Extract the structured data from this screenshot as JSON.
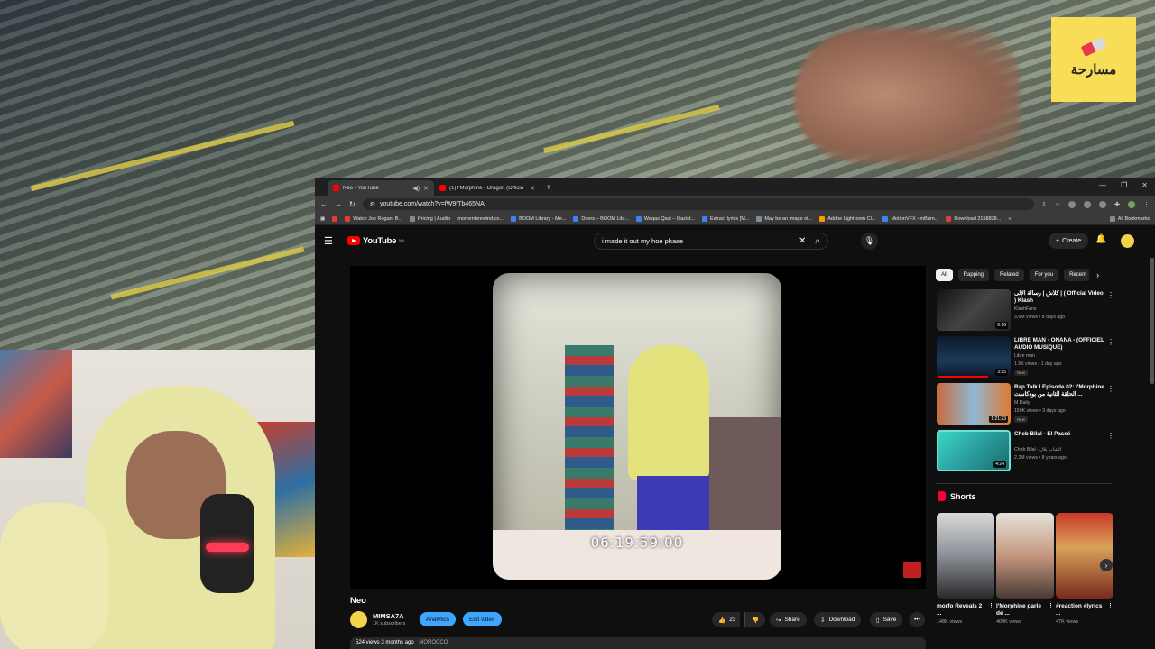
{
  "overlay": {
    "logo_text": "مسارحة"
  },
  "browser": {
    "tabs": [
      {
        "label": "Neo - YouTube",
        "active": true
      },
      {
        "label": "(1) l'Morphine - Dragon (Officia",
        "active": false
      }
    ],
    "url": "youtube.com/watch?v=fW9fTb465NA",
    "bookmarks": [
      "Watch Joe Rogan: B...",
      "Pricing | Audiio",
      "momentsrewind.co...",
      "BOOM Library - Me...",
      "Doors – BOOM Libr...",
      "Waqas Qazi – Qazist...",
      "Extract lyrics [M...",
      "May be an image of...",
      "Adobe Lightroom Cl...",
      "MotionVFX - mBurn...",
      "Download 2158838..."
    ],
    "all_bookmarks": "All Bookmarks"
  },
  "youtube": {
    "logo": "YouTube",
    "region": "MA",
    "search_query": "i made it out my hoe phase",
    "create_label": "Create",
    "video": {
      "timecode": "06:19:59:00",
      "title": "Neo",
      "channel": "MIMSA7A",
      "subscribers": "1K subscribers",
      "analytics_label": "Analytics",
      "edit_label": "Edit video",
      "likes": "23",
      "share_label": "Share",
      "download_label": "Download",
      "save_label": "Save",
      "views": "524 views",
      "age": "3 months ago",
      "location": "MOROCCO"
    },
    "chips": [
      "All",
      "Rapping",
      "Related",
      "For you",
      "Recent"
    ],
    "recommendations": [
      {
        "title": "كلاش | رسالة الإلى | ( Official Video ) Klash",
        "channel": "KlashFans",
        "meta": "3.6M views • 8 days ago",
        "duration": "6:16",
        "new": false
      },
      {
        "title": "LIBRE MAN - ONANA - (OFFICIEL AUDIO MUSIQUE)",
        "channel": "Libre man",
        "meta": "1.5K views • 1 day ago",
        "duration": "3:15",
        "new": true
      },
      {
        "title": "Rap Talk I Episode 02: l'Morphine الحلقة الثانية من بودكاست ...",
        "channel": "M Daily",
        "meta": "159K views • 3 days ago",
        "duration": "1:21:23",
        "new": true
      },
      {
        "title": "Cheb Bilal - El Passé",
        "channel": "Cheb Bilal - الشاب بلال",
        "meta": "2.2M views • 8 years ago",
        "duration": "4:24",
        "new": false
      }
    ],
    "shorts_title": "Shorts",
    "shorts": [
      {
        "title": "morfo Reveals 2 ...",
        "views": "148K views"
      },
      {
        "title": "l'Morphine parle de ...",
        "views": "409K views"
      },
      {
        "title": "#reaction #lyrics ...",
        "views": "47K views"
      }
    ]
  }
}
